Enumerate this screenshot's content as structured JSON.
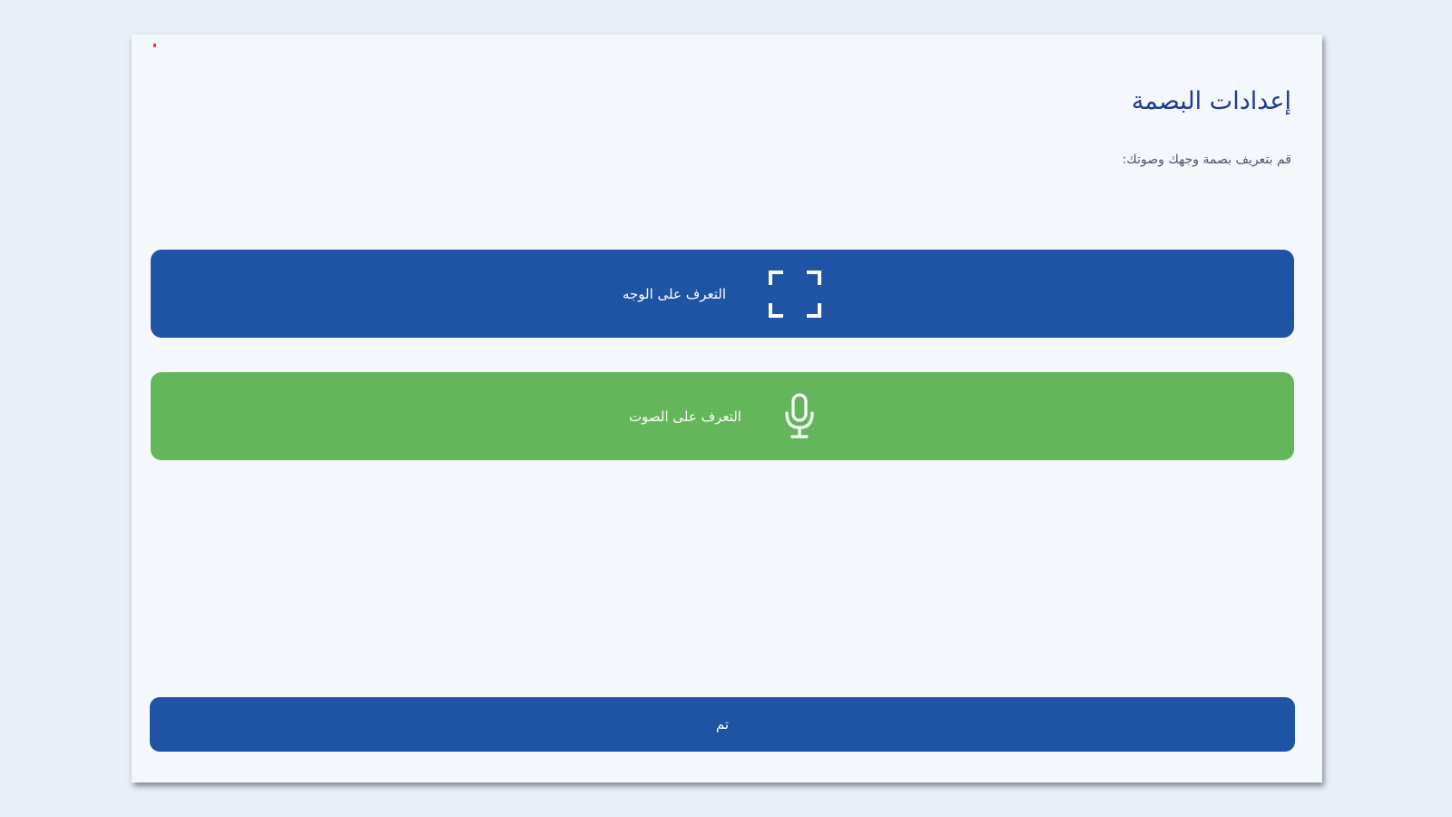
{
  "page": {
    "title": "إعدادات البصمة",
    "subtitle": "قم بتعريف بصمة وجهك وصوتك:"
  },
  "buttons": {
    "face": {
      "label": "التعرف على الوجه",
      "icon": "face-scan-frame-icon"
    },
    "voice": {
      "label": "التعرف على الصوت",
      "icon": "microphone-icon"
    },
    "done": {
      "label": "تم"
    }
  },
  "colors": {
    "primary": "#1f53a3",
    "success": "#64b65a",
    "title": "#1c3c96",
    "background": "#f4f8fd"
  }
}
